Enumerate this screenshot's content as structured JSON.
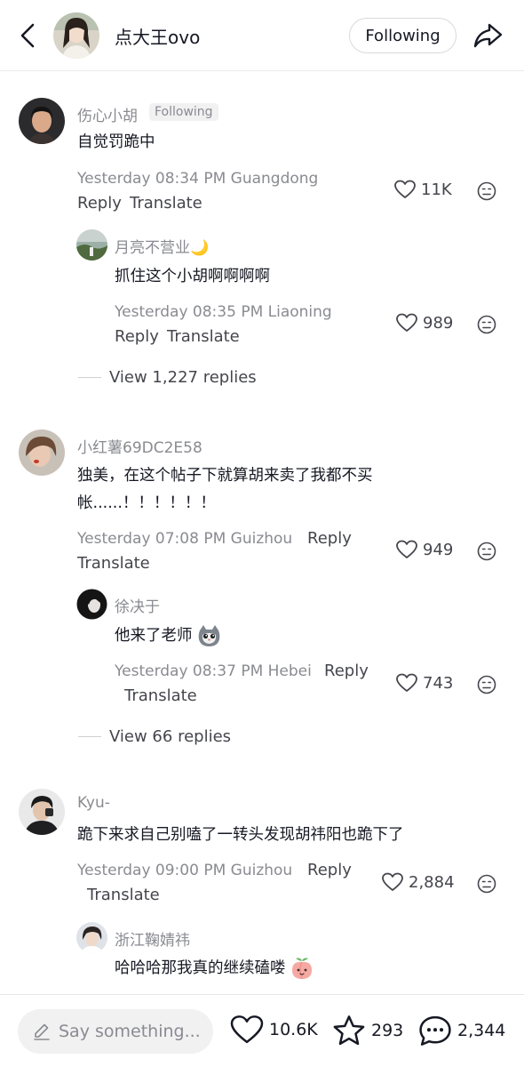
{
  "header": {
    "title": "点大王ovo",
    "following_label": "Following"
  },
  "comments": [
    {
      "user": "伤心小胡",
      "badge": "Following",
      "lines": [
        "自觉罚跪中"
      ],
      "meta": "Yesterday 08:34 PM Guangdong",
      "reply": "Reply",
      "translate": "Translate",
      "likes": "11K",
      "sub": {
        "user": "月亮不营业🌙",
        "lines": [
          "抓住这个小胡啊啊啊啊"
        ],
        "meta": "Yesterday 08:35 PM Liaoning",
        "reply": "Reply",
        "translate": "Translate",
        "likes": "989"
      },
      "view_more": "View 1,227 replies"
    },
    {
      "user": "小红薯69DC2E58",
      "lines": [
        "独美，在这个帖子下就算胡来卖了我都不买",
        "帐......！！！！！！"
      ],
      "meta": "Yesterday 07:08 PM Guizhou",
      "reply": "Reply",
      "translate": "Translate",
      "likes": "949",
      "sub": {
        "user": "徐决于",
        "lines": [
          "他来了老师"
        ],
        "meta": "Yesterday 08:37 PM Hebei",
        "reply": "Reply",
        "translate": "Translate",
        "likes": "743"
      },
      "view_more": "View 66 replies"
    },
    {
      "user": "Kyu-",
      "lines": [
        "跪下来求自己别嗑了一转头发现胡祎阳也跪下了"
      ],
      "meta": "Yesterday 09:00 PM Guizhou",
      "reply": "Reply",
      "translate": "Translate",
      "likes": "2,884",
      "sub": {
        "user": "浙江鞠婧祎",
        "lines": [
          "哈哈哈那我真的继续磕喽"
        ]
      }
    }
  ],
  "bottom": {
    "placeholder": "Say something...",
    "likes": "10.6K",
    "stars": "293",
    "comments": "2,344"
  },
  "icons": {
    "back": "chevron-left-icon",
    "share": "share-arrow-icon",
    "like": "heart-icon",
    "dislike": "dislike-face-icon",
    "star": "star-icon",
    "comment": "comment-bubble-icon",
    "edit": "pencil-icon"
  },
  "colors": {
    "text": "#161823",
    "secondary": "#8a8b91",
    "action": "#45464d",
    "badge_bg": "#f1f1f2"
  }
}
